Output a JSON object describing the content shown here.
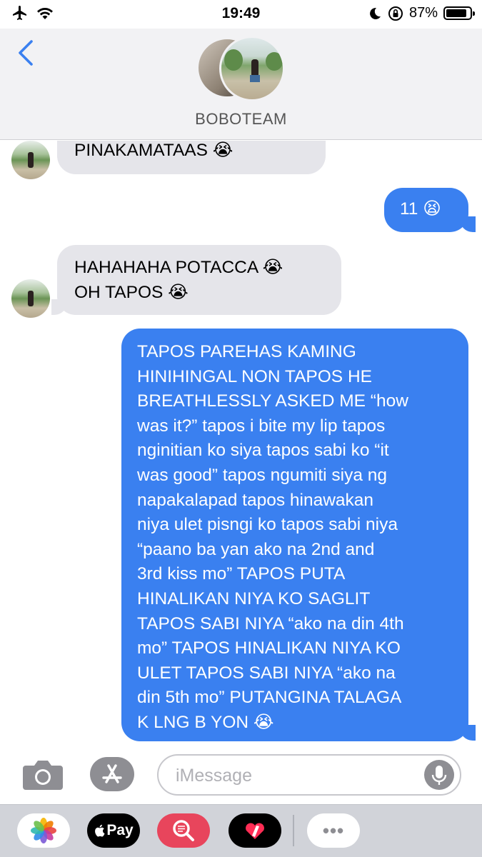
{
  "status_bar": {
    "time": "19:49",
    "battery_percent": "87%",
    "battery_level": 0.87
  },
  "header": {
    "group_name": "BOBOTEAM"
  },
  "messages": [
    {
      "direction": "incoming",
      "lines": [
        "PINAKAMATAAS 😭"
      ]
    },
    {
      "direction": "outgoing",
      "lines": [
        "11 😫"
      ]
    },
    {
      "direction": "incoming",
      "lines": [
        "HAHAHAHA POTACCA 😭",
        "OH TAPOS 😭"
      ]
    },
    {
      "direction": "outgoing",
      "lines": [
        "TAPOS PAREHAS KAMING",
        "HINIHINGAL NON TAPOS HE",
        "BREATHLESSLY ASKED ME “how",
        "was it?” tapos i bite my lip tapos",
        "nginitian ko siya tapos sabi ko “it",
        "was good” tapos ngumiti siya ng",
        "napakalapad tapos hinawakan",
        "niya ulet pisngi ko tapos sabi niya",
        "“paano ba yan ako na 2nd and",
        "3rd kiss mo” TAPOS PUTA",
        "HINALIKAN NIYA KO SAGLIT",
        "TAPOS SABI NIYA “ako na din 4th",
        "mo” TAPOS HINALIKAN NIYA KO",
        "ULET TAPOS SABI NIYA “ako na",
        "din 5th mo” PUTANGINA TALAGA",
        "K LNG B YON 😭"
      ]
    }
  ],
  "input": {
    "placeholder": "iMessage"
  },
  "app_drawer": {
    "apple_pay_label": "Pay",
    "more_label": "•••"
  },
  "icons": {
    "status_left": [
      "airplane-icon",
      "wifi-icon"
    ],
    "status_right": [
      "moon-icon",
      "orientation-lock-icon",
      "battery-icon"
    ],
    "input": [
      "camera-icon",
      "app-store-icon",
      "microphone-icon"
    ],
    "drawer": [
      "photos-icon",
      "apple-pay-icon",
      "image-search-icon",
      "digital-touch-icon",
      "more-icon"
    ]
  },
  "colors": {
    "outgoing_bubble": "#3a80f0",
    "incoming_bubble": "#e5e5ea",
    "back_chevron": "#3a80f0"
  }
}
